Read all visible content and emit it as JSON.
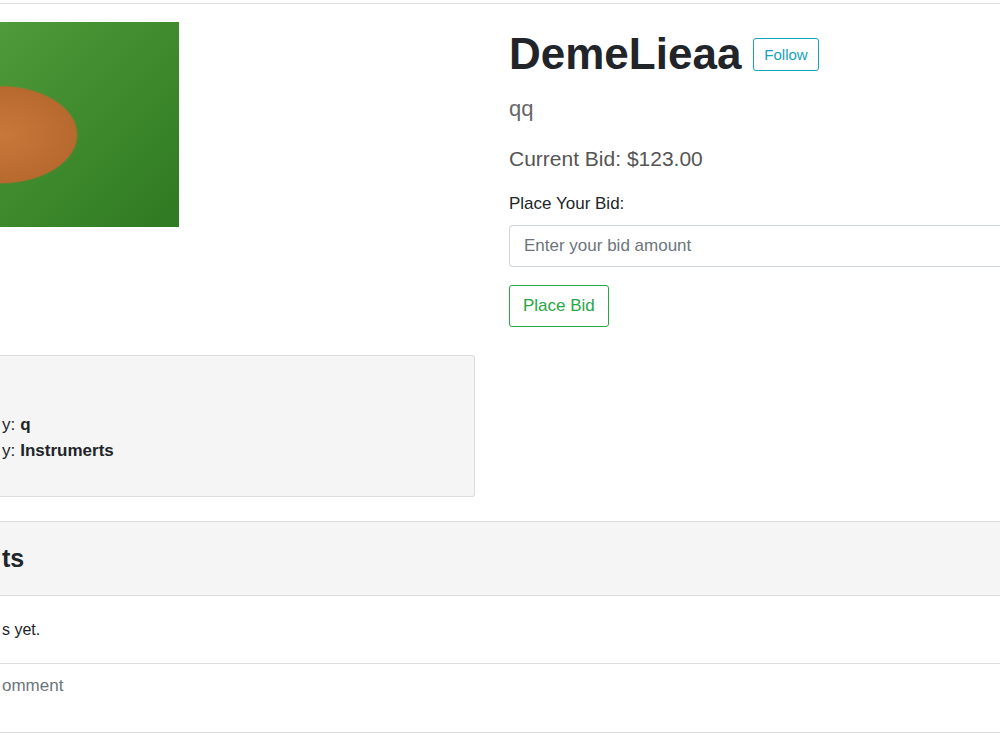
{
  "listing": {
    "title": "DemeLieaa",
    "follow_button": "Follow",
    "description": "qq",
    "current_bid": "Current Bid: $123.00",
    "bid_label": "Place Your Bid:",
    "bid_placeholder": "Enter your bid amount",
    "bid_button": "Place Bid"
  },
  "details": [
    {
      "label": "y:",
      "value": "q"
    },
    {
      "label": "y:",
      "value": "Instrumerts"
    }
  ],
  "comments": {
    "heading": "ts",
    "empty": "s yet.",
    "input_placeholder": "omment"
  }
}
